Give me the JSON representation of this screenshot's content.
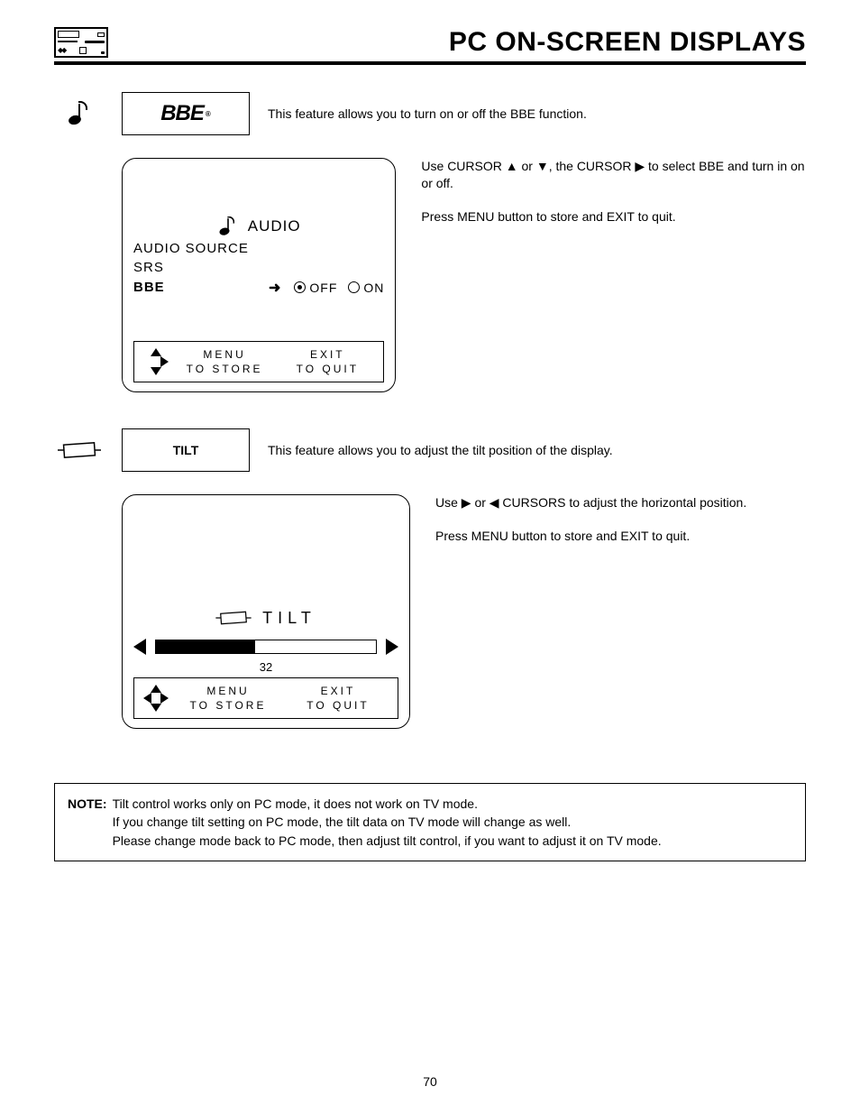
{
  "header": {
    "title": "PC ON-SCREEN DISPLAYS"
  },
  "page_number": "70",
  "bbe": {
    "label": "BBE",
    "reg": "®",
    "desc": "This feature allows you to turn on or off the BBE function.",
    "side1": "Use CURSOR ▲ or ▼, the CURSOR ▶ to select BBE and turn in on or off.",
    "side2": "Press MENU button to store and EXIT to quit.",
    "osd": {
      "title": "AUDIO",
      "item1": "AUDIO SOURCE",
      "item2": "SRS",
      "item3": "BBE",
      "off": "OFF",
      "on": "ON",
      "footer_menu1": "MENU",
      "footer_menu2": "TO STORE",
      "footer_exit1": "EXIT",
      "footer_exit2": "TO QUIT"
    }
  },
  "tilt": {
    "label": "TILT",
    "desc": "This feature allows you to adjust the tilt position of the display.",
    "side1": "Use ▶ or ◀ CURSORS to adjust the horizontal position.",
    "side2": "Press MENU button to store and EXIT to quit.",
    "osd": {
      "title": "TILT",
      "value": "32",
      "footer_menu1": "MENU",
      "footer_menu2": "TO STORE",
      "footer_exit1": "EXIT",
      "footer_exit2": "TO QUIT"
    }
  },
  "note": {
    "label": "NOTE:",
    "l1": "Tilt control works only on PC mode, it does not work on TV mode.",
    "l2": "If you change tilt setting on PC mode, the tilt data on TV mode will change as well.",
    "l3": "Please change mode back to PC mode, then adjust tilt control, if you want to adjust it on TV mode."
  }
}
